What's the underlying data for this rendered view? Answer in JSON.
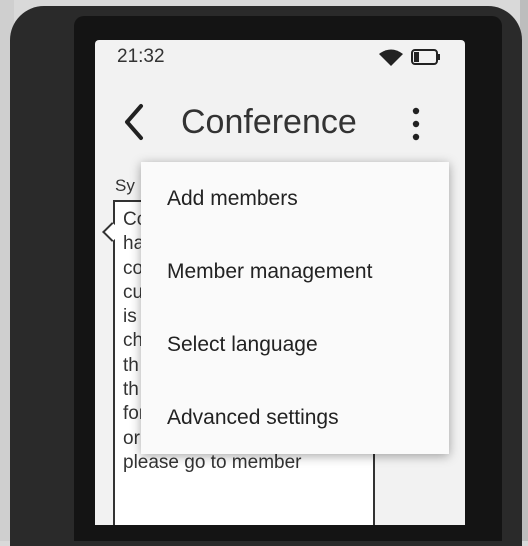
{
  "status_bar": {
    "time": "21:32"
  },
  "header": {
    "title": "Conference"
  },
  "content": {
    "label": "Sy",
    "text": "Co\nha\nco\ncu\nis\nch\nth\nth\nfor leaving conference\nor kicking member,\nplease go to member"
  },
  "menu": {
    "items": [
      {
        "label": "Add members"
      },
      {
        "label": "Member management"
      },
      {
        "label": "Select language"
      },
      {
        "label": "Advanced settings"
      }
    ]
  },
  "icons": {
    "back": "back-arrow-icon",
    "more": "more-vert-icon",
    "wifi": "wifi-icon",
    "battery": "battery-icon"
  }
}
